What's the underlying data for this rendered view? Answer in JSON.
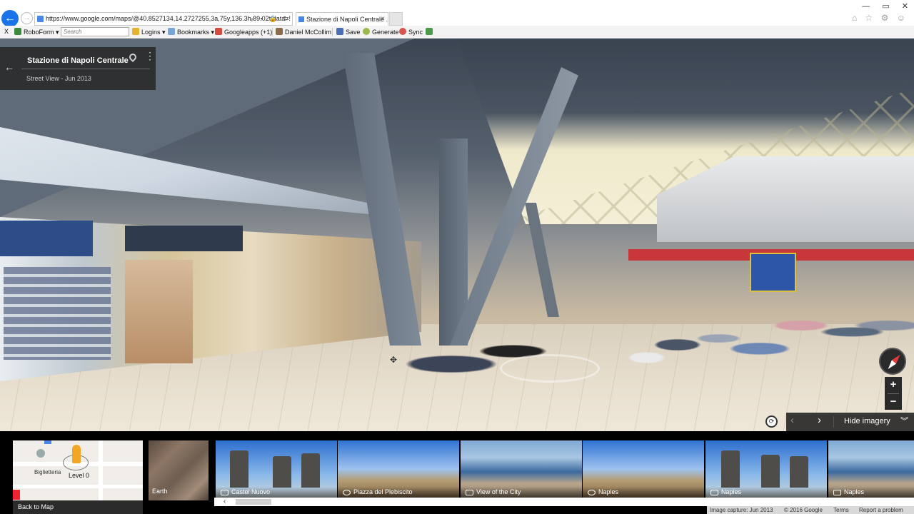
{
  "browser": {
    "url": "https://www.google.com/maps/@40.8527134,14.2727255,3a,75y,136.3h,89.02t/data=!",
    "address_tools": "⌕ ▾ 🔒 ↻",
    "tab_title": "Stazione di Napoli Centrale ...",
    "tab_close": "×",
    "window_controls": "— ▭ ✕",
    "browser_icons": "⌂ ☆ ⚙ ☺"
  },
  "toolbar": {
    "close": "X",
    "roboform": "RoboForm ▾",
    "search_placeholder": "Search",
    "logins": "Logins ▾",
    "bookmarks": "Bookmarks ▾",
    "googleapps": "Googleapps (+1)",
    "user": "Daniel McCollim",
    "save": "Save",
    "generate": "Generate",
    "sync": "Sync"
  },
  "info_card": {
    "back": "←",
    "title": "Stazione di Napoli Centrale",
    "subtitle": "Street View - Jun 2013",
    "more": "⋮"
  },
  "controls": {
    "zoom_in": "+",
    "zoom_out": "−",
    "prev": "‹",
    "next": "›",
    "hide_imagery": "Hide imagery",
    "hide_chevron": "︾",
    "timemachine": "⟳",
    "cursor": "✥"
  },
  "minimap": {
    "label": "Biglietteria",
    "level": "Level 0",
    "back_to_map": "Back to Map"
  },
  "earth_label": "Earth",
  "thumbnails": [
    {
      "caption": "Castel Nuovo",
      "kind": "photo"
    },
    {
      "caption": "Piazza del Plebiscito",
      "kind": "pano"
    },
    {
      "caption": "View of the City",
      "kind": "photo"
    },
    {
      "caption": "Naples",
      "kind": "pano"
    },
    {
      "caption": "Naples",
      "kind": "photo"
    },
    {
      "caption": "Naples",
      "kind": "photo"
    }
  ],
  "scroll": {
    "left": "‹",
    "right": "›"
  },
  "footer": {
    "capture": "Image capture: Jun 2013",
    "copyright": "© 2016 Google",
    "terms": "Terms",
    "report": "Report a problem"
  },
  "colors": {
    "accent_blue": "#1a73e8",
    "compass_red": "#e23b3b",
    "pegman_orange": "#f3a623",
    "overlay_dark": "#282828"
  }
}
